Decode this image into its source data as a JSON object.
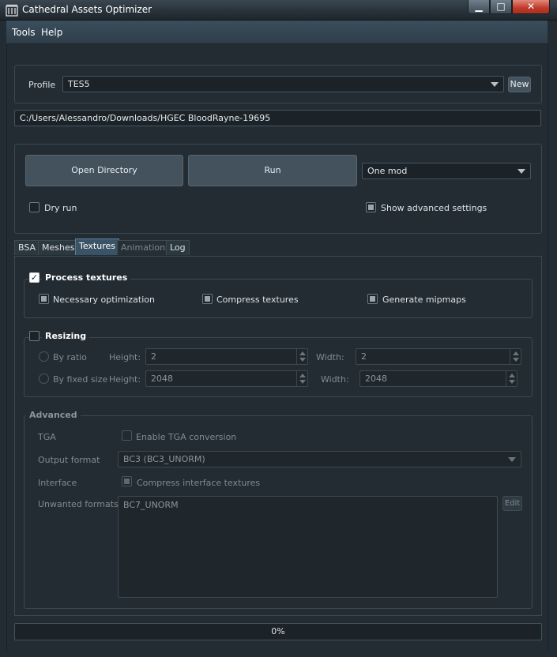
{
  "window": {
    "title": "Cathedral Assets Optimizer",
    "controls": {
      "minimize": "▁",
      "maximize": "□",
      "close": "✕"
    }
  },
  "menu": {
    "tools": "Tools",
    "help": "Help"
  },
  "profile": {
    "label": "Profile",
    "value": "TES5",
    "new_label": "New"
  },
  "path": {
    "value": "C:/Users/Alessandro/Downloads/HGEC BloodRayne-19695"
  },
  "actions": {
    "open_directory": "Open Directory",
    "run": "Run",
    "mode_value": "One mod",
    "dry_run": "Dry run",
    "show_advanced": "Show advanced settings"
  },
  "tabs": [
    {
      "label": "BSA"
    },
    {
      "label": "Meshes"
    },
    {
      "label": "Textures"
    },
    {
      "label": "Animations"
    },
    {
      "label": "Log"
    }
  ],
  "process_textures": {
    "title": "Process textures",
    "necessary_optimization": "Necessary optimization",
    "compress_textures": "Compress textures",
    "generate_mipmaps": "Generate mipmaps"
  },
  "resizing": {
    "title": "Resizing",
    "by_ratio": "By ratio",
    "by_fixed_size": "By fixed size",
    "height_label": "Height:",
    "width_label": "Width:",
    "ratio_height": "2",
    "ratio_width": "2",
    "fixed_height": "2048",
    "fixed_width": "2048"
  },
  "advanced": {
    "title": "Advanced",
    "tga_label": "TGA",
    "tga_option": "Enable TGA conversion",
    "output_format_label": "Output format",
    "output_format_value": "BC3 (BC3_UNORM)",
    "interface_label": "Interface",
    "interface_option": "Compress interface textures",
    "unwanted_label": "Unwanted formats",
    "unwanted_value": "BC7_UNORM",
    "edit_label": "Edit"
  },
  "progress": {
    "text": "0%",
    "value": 0
  },
  "colors": {
    "background": "#232c33",
    "accent": "#3a5366",
    "close": "#c0392b"
  }
}
